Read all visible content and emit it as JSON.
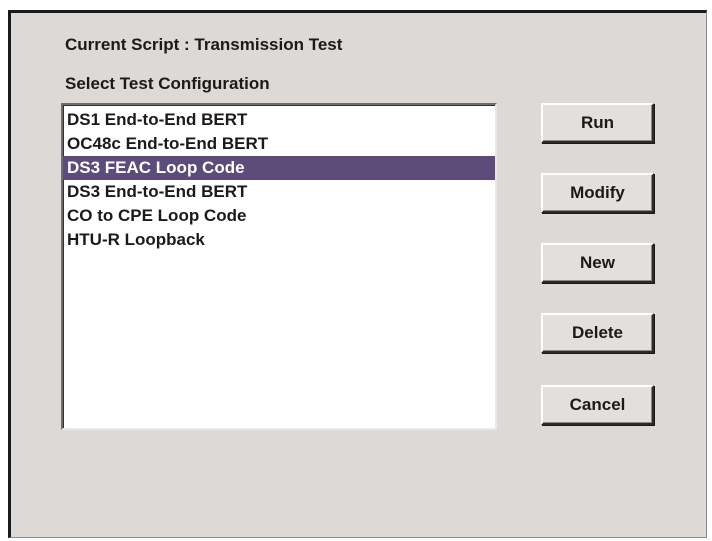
{
  "header": {
    "current_script": "Current Script : Transmission Test"
  },
  "config_list": {
    "label": "Select Test Configuration",
    "items": [
      "DS1 End-to-End BERT",
      "OC48c End-to-End BERT",
      "DS3 FEAC Loop Code",
      "DS3 End-to-End BERT",
      "CO to CPE Loop Code",
      "HTU-R Loopback"
    ],
    "selected_item": "DS3 FEAC Loop Code"
  },
  "buttons": {
    "run": "Run",
    "modify": "Modify",
    "new": "New",
    "delete": "Delete",
    "cancel": "Cancel"
  },
  "colors": {
    "selection_background": "#5d4c79",
    "dialog_background": "#dcd9d6"
  }
}
